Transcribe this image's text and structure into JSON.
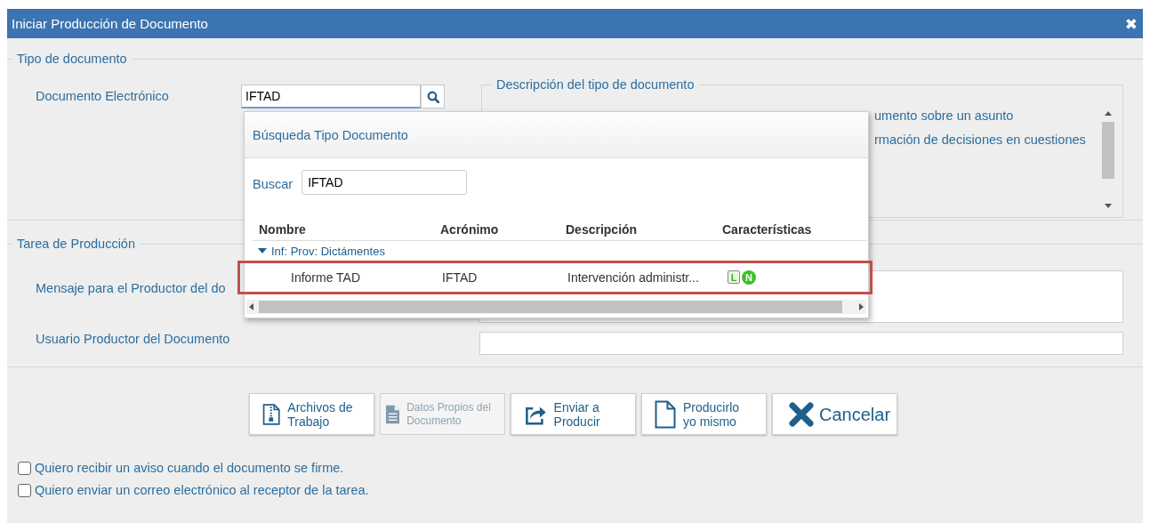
{
  "window": {
    "title": "Iniciar Producción de Documento",
    "close": "✖"
  },
  "tipo_documento": {
    "legend": "Tipo de documento",
    "field_label": "Documento Electrónico",
    "value": "IFTAD",
    "description": {
      "legend": "Descripción del tipo de documento",
      "lines": [
        "umento sobre un asunto",
        "rmación de decisiones en cuestiones"
      ]
    }
  },
  "tarea": {
    "legend": "Tarea de Producción",
    "fields": [
      {
        "label": "Mensaje para el Productor del do",
        "kind": "textarea"
      },
      {
        "label": "Usuario Productor del Documento",
        "kind": "input"
      }
    ]
  },
  "buttons": [
    {
      "label": "Archivos de Trabajo",
      "kind": "archive",
      "disabled": false
    },
    {
      "label": "Datos Propios del Documento",
      "kind": "data",
      "disabled": true
    },
    {
      "label": "Enviar a Producir",
      "kind": "send",
      "disabled": false
    },
    {
      "label": "Producirlo yo mismo",
      "kind": "page",
      "disabled": false
    },
    {
      "label": "Cancelar",
      "kind": "cancel",
      "disabled": false
    }
  ],
  "checkboxes": [
    {
      "label": "Quiero recibir un aviso cuando el documento se firme.",
      "checked": false
    },
    {
      "label": "Quiero enviar un correo electrónico al receptor de la tarea.",
      "checked": false
    }
  ],
  "popup": {
    "title": "Búsqueda Tipo Documento",
    "search_label": "Buscar",
    "search_value": "IFTAD",
    "columns": [
      "Nombre",
      "Acrónimo",
      "Descripción",
      "Características"
    ],
    "group": {
      "label": "Inf: Prov: Dictámentes",
      "expanded": true
    },
    "rows": [
      {
        "nombre": "Informe TAD",
        "acronimo": "IFTAD",
        "descripcion": "Intervención administr...",
        "highlighted": true,
        "features": [
          {
            "letter": "L",
            "kind": "square"
          },
          {
            "letter": "N",
            "kind": "round"
          }
        ]
      }
    ]
  }
}
